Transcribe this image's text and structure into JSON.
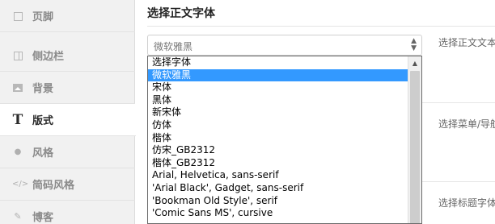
{
  "sidebar": {
    "items": [
      {
        "label": "页脚",
        "icon": "square-icon"
      },
      {
        "label": "侧边栏",
        "icon": "columns-icon"
      },
      {
        "label": "背景",
        "icon": "image-icon"
      },
      {
        "label": "版式",
        "icon": "T",
        "active": true
      },
      {
        "label": "风格",
        "icon": "droplet-icon",
        "glyph": "💧"
      },
      {
        "label": "简码风格",
        "icon": "code-icon",
        "glyph": "</>"
      },
      {
        "label": "博客",
        "icon": "pin-icon",
        "glyph": "✎"
      }
    ]
  },
  "main": {
    "section_title": "选择正文字体",
    "select": {
      "value": "微软雅黑"
    },
    "descriptions": [
      "选择正文文本",
      "选择菜单/导航",
      "选择标题字体"
    ],
    "dropdown": {
      "options": [
        "选择字体",
        "微软雅黑",
        "宋体",
        "黑体",
        "新宋体",
        "仿体",
        "楷体",
        "仿宋_GB2312",
        "楷体_GB2312",
        "Arial, Helvetica, sans-serif",
        "'Arial Black', Gadget, sans-serif",
        "'Bookman Old Style', serif",
        "'Comic Sans MS', cursive"
      ],
      "selected_index": 1
    }
  },
  "colors": {
    "accent": "#3399ff",
    "sidebar_bg": "#f1f1f1"
  }
}
